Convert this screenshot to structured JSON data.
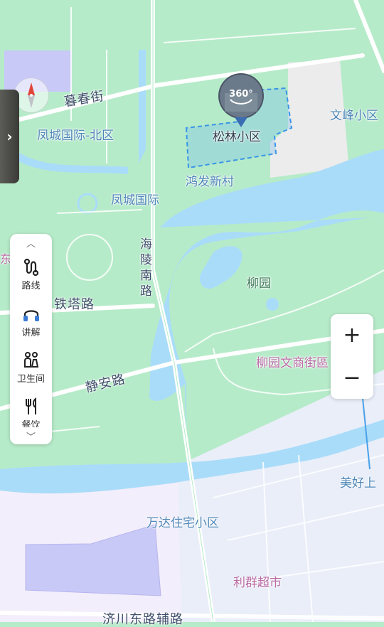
{
  "map_labels": {
    "muchun_street": "暮春街",
    "fengcheng_north": "凤城国际-北区",
    "fengcheng": "凤城国际",
    "songlin": "松林小区",
    "wenfeng": "文峰小区",
    "hongfa": "鸿发新村",
    "hailing_road": "海陵南路",
    "liuyuan": "柳园",
    "tieta_road": "铁塔路",
    "liuyuan_street": "柳园文商街區",
    "jingan_road": "静安路",
    "meihao": "美好上",
    "wanda": "万达住宅小区",
    "liqun": "利群超市",
    "jichuan_road": "济川东路辅路",
    "left_edge": "东"
  },
  "marker": {
    "badge": "360°"
  },
  "tool_panel": {
    "items": [
      {
        "label": "路线",
        "icon": "route-icon"
      },
      {
        "label": "讲解",
        "icon": "headphones-icon"
      },
      {
        "label": "卫生间",
        "icon": "restroom-icon"
      },
      {
        "label": "餐饮",
        "icon": "dining-icon"
      }
    ]
  },
  "zoom": {
    "in": "+",
    "out": "−"
  },
  "colors": {
    "land": "#b6ebc9",
    "water": "#a9dcf9",
    "urban": "#e8eef9",
    "road": "#ffffff",
    "boundary": "#3a95e6"
  }
}
